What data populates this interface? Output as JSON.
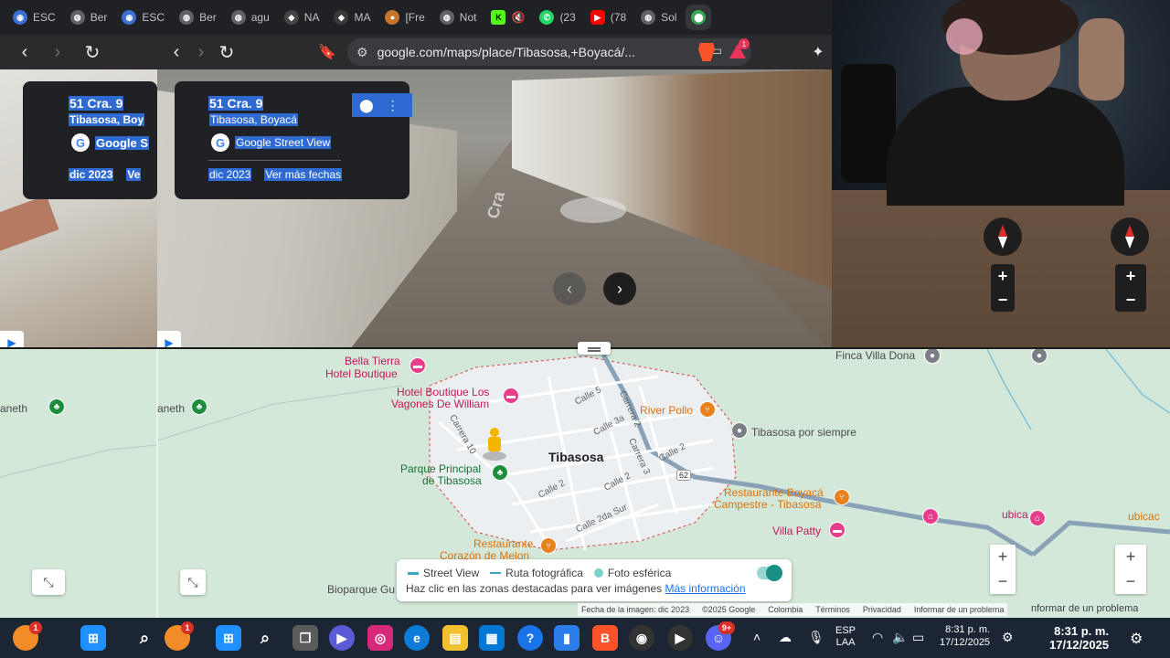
{
  "tabs": [
    {
      "label": "ESC",
      "icon": "blue-circle-icon",
      "color": "#3b6fd1"
    },
    {
      "label": "Ber",
      "icon": "gray-circle-icon",
      "color": "#5f6368"
    },
    {
      "label": "ESC",
      "icon": "blue-circle-icon",
      "color": "#3b6fd1"
    },
    {
      "label": "Ber",
      "icon": "gray-circle-icon",
      "color": "#5f6368"
    },
    {
      "label": "agu",
      "icon": "gray-circle-icon",
      "color": "#5f6368"
    },
    {
      "label": "NA",
      "icon": "dark-circle-icon",
      "color": "#444"
    },
    {
      "label": "MA",
      "icon": "dark-circle-icon",
      "color": "#3a3a3a"
    },
    {
      "label": "[Fre",
      "icon": "orange-circle-icon",
      "color": "#c6762a"
    },
    {
      "label": "Not",
      "icon": "gray-circle-icon",
      "color": "#5f6368"
    },
    {
      "label": "",
      "icon": "kick-icon",
      "color": "#53fc18"
    },
    {
      "label": "(23",
      "icon": "whatsapp-icon",
      "color": "#25d366"
    },
    {
      "label": "(78",
      "icon": "youtube-icon",
      "color": "#ff0000"
    },
    {
      "label": "Sol",
      "icon": "gray-circle-icon",
      "color": "#5f6368"
    },
    {
      "label": "",
      "icon": "maps-icon",
      "color": "#34a853"
    }
  ],
  "toolbar": {
    "url": "google.com/maps/place/Tibasosa,+Boyacá/...",
    "brave_badge": "",
    "rewards_badge": "1"
  },
  "infocard": {
    "title": "51 Cra. 9",
    "subtitle": "Tibasosa, Boyacá",
    "provider": "Google Street View",
    "date": "dic 2023",
    "more_dates": "Ver más fechas"
  },
  "mirror_card": {
    "title": "51 Cra. 9",
    "subtitle": "Tibasosa, Boy",
    "provider": "Google S",
    "date": "dic 2023",
    "more": "Ve"
  },
  "map": {
    "labels": {
      "bella_tierra": "Bella Tierra",
      "hotel_boutique": "Hotel Boutique",
      "vagones_1": "Hotel Boutique Los",
      "vagones_2": "Vagones De William",
      "river_pollo": "River Pollo",
      "finca_villa_dona": "Finca Villa Dona",
      "tibasosa_por_siempre": "Tibasosa por siempre",
      "town": "Tibasosa",
      "parque_1": "Parque Principal",
      "parque_2": "de Tibasosa",
      "restaurante_boyaca_1": "Restaurante Boyacá",
      "restaurante_boyaca_2": "Campestre - Tibasosa",
      "villa_patty": "Villa Patty",
      "ubica": "ubica",
      "ubica_mirror": "ubicac",
      "restaurante_corazon_1": "Restaurante",
      "restaurante_corazon_2": "Corazón de Melon",
      "bioparque": "Bioparque Gu",
      "aneth": "aneth",
      "aneth_mirror": "aneth",
      "calle5": "Calle 5",
      "carrera2": "Carrera 2",
      "calle3a": "Calle 3a",
      "carrera10": "Carrera 10",
      "carrera3": "Carrera 3",
      "calle2a": "Calle 2",
      "calle2b": "Calle 2",
      "calle2": "Calle 2",
      "calle2dasur": "Calle 2da Sur",
      "route62": "62",
      "cra_road": "Cra"
    },
    "legend": {
      "street_view": "Street View",
      "ruta": "Ruta fotográfica",
      "foto": "Foto esférica",
      "hint": "Haz clic en las zonas destacadas para ver imágenes",
      "link": "Más información"
    },
    "attribution": [
      "Fecha de la imagen: dic 2023",
      "©2025 Google",
      "Colombia",
      "Términos",
      "Privacidad",
      "Informar de un problema"
    ],
    "attribution_mirror": "nformar de un problema"
  },
  "taskbar": {
    "search_badge": "1",
    "app_badge": "1",
    "discord_badge": "9+",
    "lang_top": "ESP",
    "lang_bottom": "LAA",
    "time": "8:31 p. m.",
    "date": "17/12/2025",
    "time_mirror": "8:31 p. m.",
    "date_mirror": "17/12/2025"
  },
  "colors": {
    "map_bg": "#d4e8d9",
    "road": "#8aa2b7",
    "accent": "#1a73e8",
    "selection": "#2e6ad1"
  }
}
